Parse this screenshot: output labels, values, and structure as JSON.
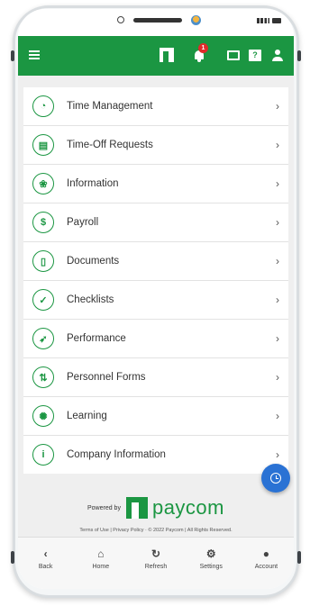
{
  "header": {
    "notification_count": "1",
    "help_glyph": "?"
  },
  "menu": [
    {
      "label": "Time Management",
      "icon": "clock-icon",
      "glyph": "◔"
    },
    {
      "label": "Time-Off Requests",
      "icon": "calendar-icon",
      "glyph": "▤"
    },
    {
      "label": "Information",
      "icon": "fingerprint-icon",
      "glyph": "❀"
    },
    {
      "label": "Payroll",
      "icon": "dollar-icon",
      "glyph": "$"
    },
    {
      "label": "Documents",
      "icon": "document-icon",
      "glyph": "▯"
    },
    {
      "label": "Checklists",
      "icon": "checkmark-icon",
      "glyph": "✓"
    },
    {
      "label": "Performance",
      "icon": "rocket-icon",
      "glyph": "➶"
    },
    {
      "label": "Personnel Forms",
      "icon": "transfer-icon",
      "glyph": "⇅"
    },
    {
      "label": "Learning",
      "icon": "lightbulb-icon",
      "glyph": "✺"
    },
    {
      "label": "Company Information",
      "icon": "info-icon",
      "glyph": "i"
    }
  ],
  "footer": {
    "powered_by": "Powered by",
    "brand": "paycom",
    "legal": "Terms of Use | Privacy Policy · © 2022 Paycom | All Rights Reserved."
  },
  "bottom_nav": [
    {
      "label": "Back",
      "icon": "back-chevron-icon",
      "glyph": "‹"
    },
    {
      "label": "Home",
      "icon": "home-icon",
      "glyph": "⌂"
    },
    {
      "label": "Refresh",
      "icon": "refresh-icon",
      "glyph": "↻"
    },
    {
      "label": "Settings",
      "icon": "gear-icon",
      "glyph": "⚙"
    },
    {
      "label": "Account",
      "icon": "user-icon",
      "glyph": "●"
    }
  ],
  "colors": {
    "brand_green": "#1b9642",
    "fab_blue": "#2a72d4",
    "badge_red": "#e02a2a"
  }
}
